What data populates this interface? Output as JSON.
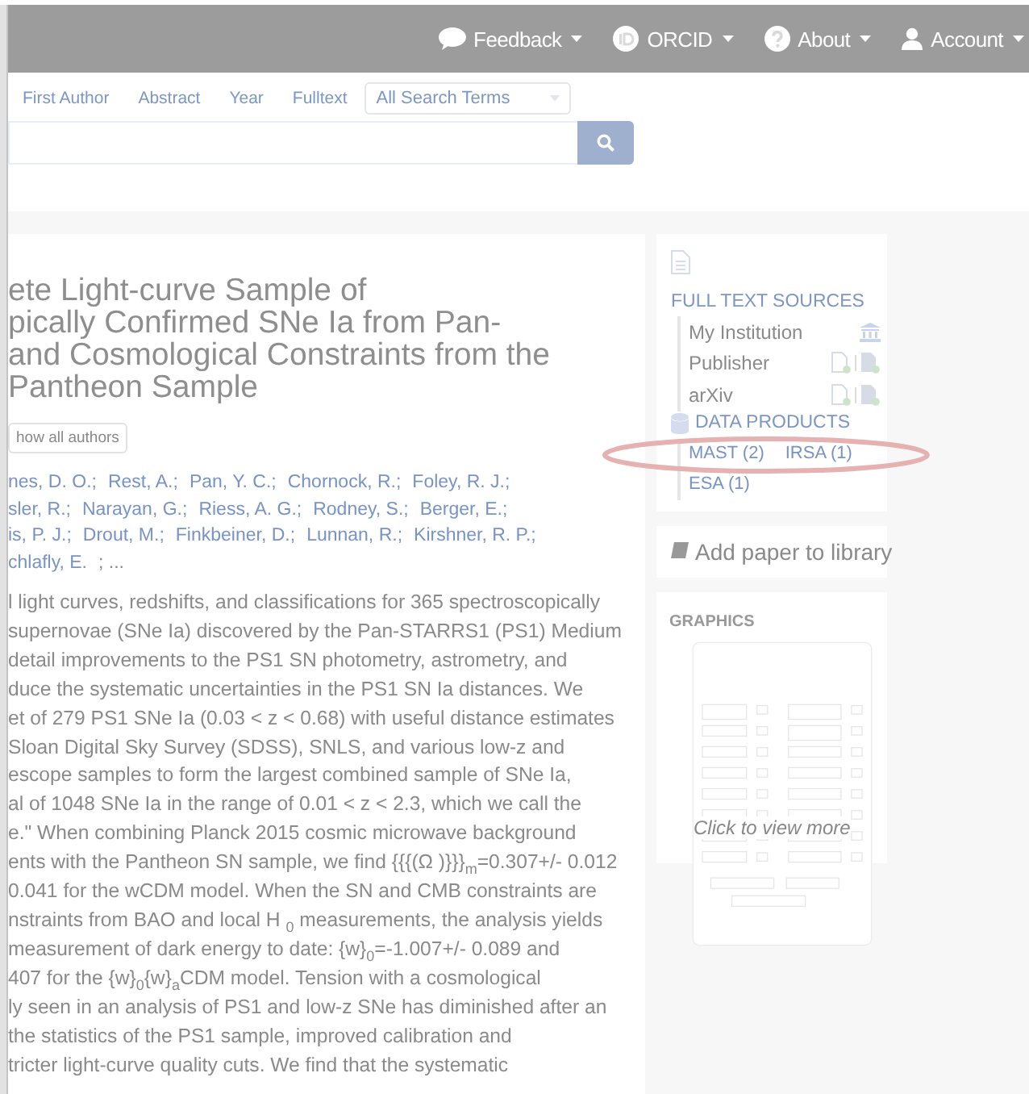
{
  "navbar": {
    "items": [
      {
        "kind": "feedback",
        "label": "Feedback"
      },
      {
        "kind": "orcid",
        "label": "ORCID"
      },
      {
        "kind": "about",
        "label": "About"
      },
      {
        "kind": "account",
        "label": "Account"
      }
    ]
  },
  "search": {
    "fields": [
      "First Author",
      "Abstract",
      "Year",
      "Fulltext"
    ],
    "select": "All Search Terms"
  },
  "title_lines": [
    "ete Light-curve Sample of",
    "pically Confirmed SNe Ia from Pan-",
    "and Cosmological Constraints from the",
    "Pantheon Sample"
  ],
  "show_all_authors": "how all authors",
  "author_lines": [
    [
      {
        "kind": "link",
        "text": "nes, D. O.;"
      },
      {
        "kind": "link",
        "text": "Rest, A.;"
      },
      {
        "kind": "link",
        "text": "Pan, Y. C.;"
      },
      {
        "kind": "link",
        "text": "Chornock, R.;"
      },
      {
        "kind": "link",
        "text": "Foley, R. J.;"
      }
    ],
    [
      {
        "kind": "link",
        "text": "sler, R.;"
      },
      {
        "kind": "link",
        "text": "Narayan, G.;"
      },
      {
        "kind": "link",
        "text": "Riess, A. G.;"
      },
      {
        "kind": "link",
        "text": "Rodney, S.;"
      },
      {
        "kind": "link",
        "text": "Berger, E.;"
      }
    ],
    [
      {
        "kind": "link",
        "text": "is, P. J.;"
      },
      {
        "kind": "link",
        "text": "Drout, M.;"
      },
      {
        "kind": "link",
        "text": "Finkbeiner, D.;"
      },
      {
        "kind": "link",
        "text": "Lunnan, R.;"
      },
      {
        "kind": "link",
        "text": "Kirshner, R. P.;"
      }
    ],
    [
      {
        "kind": "link",
        "text": "chlafly, E."
      },
      {
        "kind": "text",
        "text": "; ..."
      }
    ]
  ],
  "abstract_lines": [
    "l light curves, redshifts, and classifications for 365 spectroscopically",
    "supernovae (SNe Ia) discovered by the Pan-STARRS1 (PS1) Medium",
    "detail improvements to the PS1 SN photometry, astrometry, and",
    "duce the systematic uncertainties in the PS1 SN Ia distances. We",
    "et of 279 PS1 SNe Ia (0.03 < z < 0.68) with useful distance estimates",
    "Sloan Digital Sky Survey (SDSS), SNLS, and various low-z and",
    "escope samples to form the largest combined sample of SNe Ia,",
    "al of 1048 SNe Ia in the range of 0.01 < z < 2.3, which we call the",
    "e.\" When combining Planck 2015 cosmic microwave background",
    "ents with the Pantheon SN sample, we find {{{(Ω )}}}$_{m}$=0.307+/- 0.012",
    "0.041 for the wCDM model. When the SN and CMB constraints are",
    "nstraints from BAO and local H $_{0}$ measurements, the analysis yields",
    "measurement of dark energy to date: {w}$_{0}$=-1.007+/- 0.089 and",
    "407 for the {w}$_{0}${w}$_{a}$CDM model. Tension with a cosmological",
    "ly seen in an analysis of PS1 and low-z SNe has diminished after an",
    "the statistics of the PS1 sample, improved calibration and",
    "tricter light-curve quality cuts. We find that the systematic"
  ],
  "sidebar": {
    "full_text": {
      "heading": "FULL TEXT SOURCES",
      "sources": [
        {
          "kind": "institution",
          "label": "My Institution"
        },
        {
          "kind": "files",
          "label": "Publisher"
        },
        {
          "kind": "files",
          "label": "arXiv"
        }
      ]
    },
    "data_products": {
      "heading": "DATA PRODUCTS",
      "items": [
        "MAST (2)",
        "IRSA (1)",
        "ESA (1)"
      ]
    },
    "add_to_library": "Add paper to library",
    "graphics": {
      "heading": "GRAPHICS",
      "caption": "Click to view more"
    }
  }
}
